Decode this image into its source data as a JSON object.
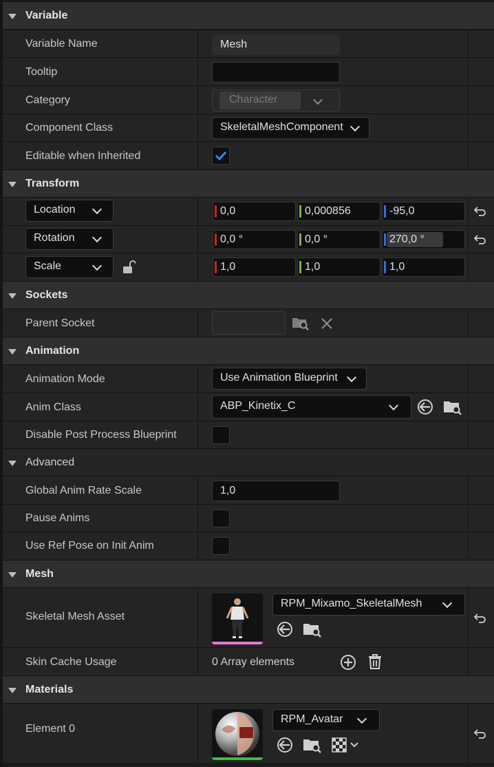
{
  "sections": {
    "variable": "Variable",
    "transform": "Transform",
    "sockets": "Sockets",
    "animation": "Animation",
    "advanced": "Advanced",
    "mesh": "Mesh",
    "materials": "Materials"
  },
  "variable": {
    "name_label": "Variable Name",
    "name_value": "Mesh",
    "tooltip_label": "Tooltip",
    "tooltip_value": "",
    "category_label": "Category",
    "category_value": "Character",
    "component_class_label": "Component Class",
    "component_class_value": "SkeletalMeshComponent",
    "editable_label": "Editable when Inherited",
    "editable_checked": true
  },
  "transform": {
    "location": {
      "label": "Location",
      "x": "0,0",
      "y": "0,000856",
      "z": "-95,0"
    },
    "rotation": {
      "label": "Rotation",
      "x": "0,0 °",
      "y": "0,0 °",
      "z": "270,0 °"
    },
    "scale": {
      "label": "Scale",
      "x": "1,0",
      "y": "1,0",
      "z": "1,0"
    }
  },
  "sockets": {
    "parent_label": "Parent Socket",
    "parent_value": ""
  },
  "animation": {
    "mode_label": "Animation Mode",
    "mode_value": "Use Animation Blueprint",
    "class_label": "Anim Class",
    "class_value": "ABP_Kinetix_C",
    "disable_pp_label": "Disable Post Process Blueprint",
    "disable_pp_checked": false
  },
  "advanced": {
    "rate_label": "Global Anim Rate Scale",
    "rate_value": "1,0",
    "pause_label": "Pause Anims",
    "pause_checked": false,
    "refpose_label": "Use Ref Pose on Init Anim",
    "refpose_checked": false
  },
  "mesh": {
    "asset_label": "Skeletal Mesh Asset",
    "asset_value": "RPM_Mixamo_SkeletalMesh",
    "skin_label": "Skin Cache Usage",
    "skin_value": "0 Array elements"
  },
  "materials": {
    "element_label": "Element 0",
    "element_value": "RPM_Avatar"
  },
  "colors": {
    "x_axis": "#c8261c",
    "y_axis": "#7fb82e",
    "z_axis": "#2f6fde",
    "check": "#2f8cff",
    "mesh_underline": "#e07bd6",
    "material_underline": "#3cbf3c"
  }
}
